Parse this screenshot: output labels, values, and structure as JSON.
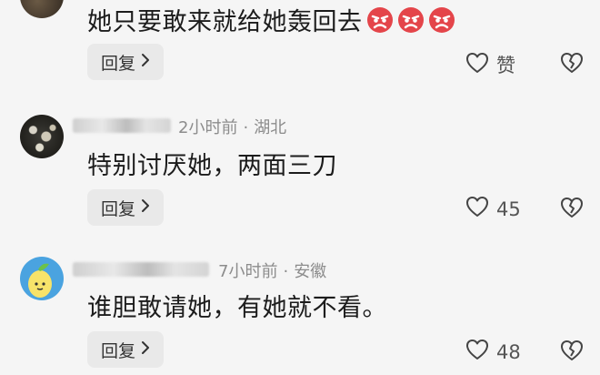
{
  "comments": [
    {
      "text": "她只要敢来就给她轰回去",
      "emoji_icon": "angry-face-icon",
      "reply_label": "回复",
      "like_label": "赞"
    },
    {
      "meta_time": "2小时前",
      "meta_separator": "·",
      "meta_location": "湖北",
      "text": "特别讨厌她，两面三刀",
      "reply_label": "回复",
      "like_count": "45"
    },
    {
      "meta_time": "7小时前",
      "meta_separator": "·",
      "meta_location": "安徽",
      "text": "谁胆敢请她，有她就不看。",
      "reply_label": "回复",
      "like_count": "48"
    }
  ]
}
